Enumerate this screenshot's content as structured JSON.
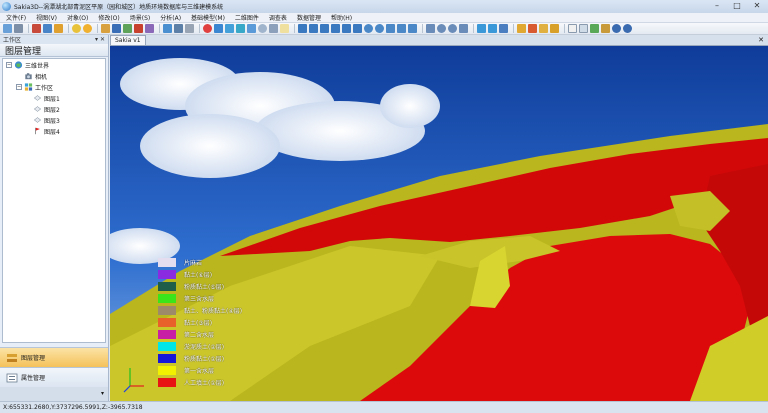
{
  "window": {
    "title": "Sakia3D--涡潭湖北部青泥区平原（园和城区）地质环境数据库与三维建模系统"
  },
  "menu": [
    "文件(F)",
    "视图(V)",
    "对象(O)",
    "修改(O)",
    "场景(S)",
    "分析(A)",
    "基础模型(M)",
    "二维图件",
    "调查表",
    "数据管理",
    "帮助(H)"
  ],
  "left_panel": {
    "caption": "工作区",
    "pin_glyph": "▾ ✕",
    "title": "图层管理",
    "tree": {
      "root": "三维世界",
      "camera": "相机",
      "workspace": "工作区",
      "layers": [
        "图层1",
        "图层2",
        "图层3",
        "图层4"
      ]
    },
    "nav": {
      "layer_manager": "图层管理",
      "property_manager": "属性管理"
    }
  },
  "viewport": {
    "tab_label": "Sakia v1",
    "close_glyph": "✕"
  },
  "legend": [
    {
      "label": "片麻岩",
      "color": "#e4ddf0"
    },
    {
      "label": "黏土(⑥层)",
      "color": "#8a2be2"
    },
    {
      "label": "粉质黏土(⑤层)",
      "color": "#1f5f4a"
    },
    {
      "label": "第三含水层",
      "color": "#3ae61a"
    },
    {
      "label": "黏土、粉质黏土(④层)",
      "color": "#9c8a6a"
    },
    {
      "label": "黏土(③层)",
      "color": "#e8602a"
    },
    {
      "label": "第二含水层",
      "color": "#c81ea6"
    },
    {
      "label": "淤泥质土(②层)",
      "color": "#00e6e6"
    },
    {
      "label": "粉质黏土(①层)",
      "color": "#1616d8"
    },
    {
      "label": "第一含水层",
      "color": "#f2f200"
    },
    {
      "label": "人工填土(①层)",
      "color": "#e81414"
    }
  ],
  "statusbar": {
    "coords": "X:655331.2680,Y:3737296.5991,Z:-3965.7318"
  }
}
